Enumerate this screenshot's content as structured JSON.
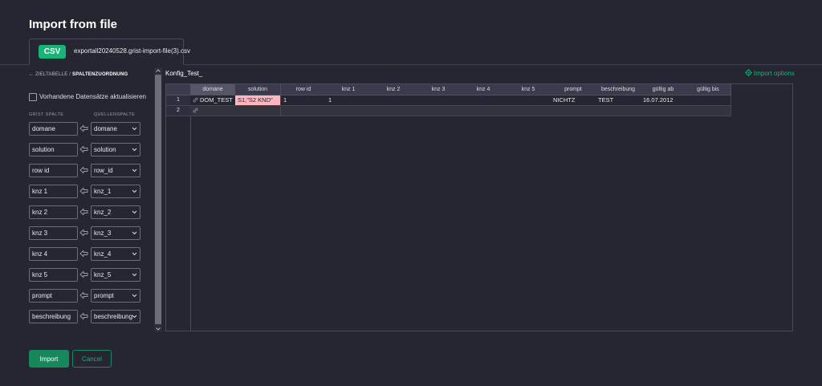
{
  "dialog": {
    "title": "Import from file"
  },
  "file_tab": {
    "badge": "CSV",
    "filename": "exportall20240528.grist-import-file(3).csv"
  },
  "left_panel": {
    "breadcrumb": {
      "back": "ZIELTABELLE",
      "separator": "/",
      "current": "SPALTENZUORDNUNG"
    },
    "update_existing_label": "Vorhandene Datensätze aktualisieren",
    "update_existing_checked": false,
    "grist_column_header": "GRIST SPALTE",
    "source_column_header": "QUELLENSPALTE",
    "mappings": [
      {
        "grist": "domane",
        "source": "domane"
      },
      {
        "grist": "solution",
        "source": "solution"
      },
      {
        "grist": "row id",
        "source": "row_id"
      },
      {
        "grist": "knz 1",
        "source": "knz_1"
      },
      {
        "grist": "knz 2",
        "source": "knz_2"
      },
      {
        "grist": "knz 3",
        "source": "knz_3"
      },
      {
        "grist": "knz 4",
        "source": "knz_4"
      },
      {
        "grist": "knz 5",
        "source": "knz_5"
      },
      {
        "grist": "prompt",
        "source": "prompt"
      },
      {
        "grist": "beschreibung",
        "source": "beschreibung"
      }
    ]
  },
  "preview": {
    "table_name": "Konfig_Test_",
    "import_options_label": "Import options",
    "columns": [
      "domane",
      "solution",
      "row id",
      "knz 1",
      "knz 2",
      "knz 3",
      "knz 4",
      "knz 5",
      "prompt",
      "beschreibung",
      "gültig ab",
      "gültig bis"
    ],
    "row_numbers": [
      "1",
      "2"
    ],
    "rows": [
      [
        "DOM_TEST",
        "S1,\"S2 KND\"",
        "1",
        "1",
        "",
        "",
        "",
        "",
        "NICHTZ",
        "TEST",
        "16.07.2012",
        ""
      ],
      [
        "",
        "",
        "",
        "",
        "",
        "",
        "",
        "",
        "",
        "",
        "",
        ""
      ]
    ]
  },
  "footer": {
    "import_label": "Import",
    "cancel_label": "Cancel"
  },
  "colors": {
    "background": "#262633",
    "accent": "#17b378",
    "primary_button": "#17875c",
    "error_cell": "#ffb6c1"
  },
  "icons": {
    "arrow": "arrow-left-icon",
    "chevron": "chevron-down-icon",
    "gear": "gear-icon",
    "link": "link-icon"
  }
}
